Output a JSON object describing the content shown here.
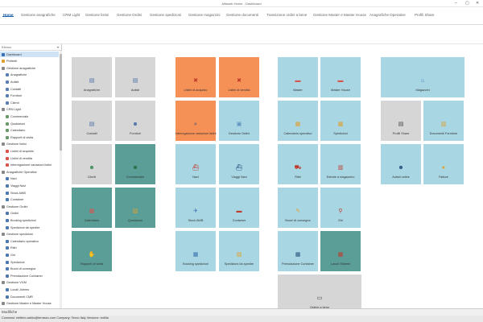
{
  "window": {
    "title": "Alfaweb Home - Dashboard"
  },
  "menu": {
    "tabs": [
      {
        "label": "Home",
        "active": true
      },
      {
        "label": "Gestione anagrafiche"
      },
      {
        "label": "CRM Light"
      },
      {
        "label": "Gestione listini"
      },
      {
        "label": "Gestione Ordini"
      },
      {
        "label": "Gestione spedizioni"
      },
      {
        "label": "Gestione magazzini"
      },
      {
        "label": "Gestione documenti"
      },
      {
        "label": "Transizione ordini a bene"
      },
      {
        "label": "Gestione Master e Master House"
      },
      {
        "label": "Anagrafiche Operative"
      },
      {
        "label": "Profili Share"
      }
    ]
  },
  "sidebar": {
    "header": "Elenco",
    "items": [
      {
        "label": "Dashboard",
        "level": 0,
        "color": "#3a6fb0",
        "selected": true
      },
      {
        "label": "Preferiti",
        "level": 0,
        "color": "#e0a030"
      },
      {
        "label": "Gestione anagrafiche",
        "level": 0,
        "color": "#888888"
      },
      {
        "label": "Anagrafiche",
        "level": 1,
        "color": "#5a7fb5"
      },
      {
        "label": "Autisti",
        "level": 1,
        "color": "#5a7fb5"
      },
      {
        "label": "Contatti",
        "level": 1,
        "color": "#5a7fb5"
      },
      {
        "label": "Fornitori",
        "level": 1,
        "color": "#5a7fb5"
      },
      {
        "label": "Clienti",
        "level": 1,
        "color": "#5a7fb5"
      },
      {
        "label": "CRM Light",
        "level": 0,
        "color": "#888888"
      },
      {
        "label": "Commerciale",
        "level": 1,
        "color": "#6a9a6a"
      },
      {
        "label": "Quotazioni",
        "level": 1,
        "color": "#6a9a6a"
      },
      {
        "label": "Calendario",
        "level": 1,
        "color": "#6a9a6a"
      },
      {
        "label": "Rapporti di visita",
        "level": 1,
        "color": "#6a9a6a"
      },
      {
        "label": "Gestione listini",
        "level": 0,
        "color": "#888888"
      },
      {
        "label": "Listini di acquisto",
        "level": 1,
        "color": "#d9534f"
      },
      {
        "label": "Listini di vendita",
        "level": 1,
        "color": "#d9534f"
      },
      {
        "label": "Interrogazione variazioni listini",
        "level": 1,
        "color": "#d9534f"
      },
      {
        "label": "Anagrafiche Operative",
        "level": 0,
        "color": "#888888"
      },
      {
        "label": "Navi",
        "level": 1,
        "color": "#4a7ab0"
      },
      {
        "label": "Viaggi Navi",
        "level": 1,
        "color": "#4a7ab0"
      },
      {
        "label": "Stock AWB",
        "level": 1,
        "color": "#4a7ab0"
      },
      {
        "label": "Container",
        "level": 1,
        "color": "#4a7ab0"
      },
      {
        "label": "Gestione Ordini",
        "level": 0,
        "color": "#888888"
      },
      {
        "label": "Ordini",
        "level": 1,
        "color": "#4a7ab0"
      },
      {
        "label": "Booking spedizioni",
        "level": 1,
        "color": "#4a7ab0"
      },
      {
        "label": "Spedizioni da spedire",
        "level": 1,
        "color": "#4a7ab0"
      },
      {
        "label": "Gestione spedizioni",
        "level": 0,
        "color": "#888888"
      },
      {
        "label": "Calendario operativo",
        "level": 1,
        "color": "#4a7ab0"
      },
      {
        "label": "Ritiri",
        "level": 1,
        "color": "#4a7ab0"
      },
      {
        "label": "Giri",
        "level": 1,
        "color": "#4a7ab0"
      },
      {
        "label": "Spedizioni",
        "level": 1,
        "color": "#4a7ab0"
      },
      {
        "label": "Buoni di consegna",
        "level": 1,
        "color": "#4a7ab0"
      },
      {
        "label": "Prenotazione Container",
        "level": 1,
        "color": "#4a7ab0"
      },
      {
        "label": "Gestione VGM",
        "level": 0,
        "color": "#888888"
      },
      {
        "label": "Locali Jolemo",
        "level": 1,
        "color": "#4a7ab0"
      },
      {
        "label": "Documenti CMR",
        "level": 1,
        "color": "#4a7ab0"
      },
      {
        "label": "Gestione Master e Master House",
        "level": 0,
        "color": "#888888"
      }
    ]
  },
  "tiles": [
    {
      "label": "Anagrafiche",
      "color": "gray",
      "icon": "id-card-icon",
      "glyph": "▤",
      "iconColor": "#4a6fa5",
      "col": 0,
      "row": 0
    },
    {
      "label": "Autisti",
      "color": "gray",
      "icon": "driver-card-icon",
      "glyph": "▤",
      "iconColor": "#4a6fa5",
      "col": 1,
      "row": 0
    },
    {
      "label": "Contatti",
      "color": "gray",
      "icon": "contact-card-icon",
      "glyph": "▤",
      "iconColor": "#4a6fa5",
      "col": 0,
      "row": 1
    },
    {
      "label": "Fornitori",
      "color": "gray",
      "icon": "suppliers-icon",
      "glyph": "☻",
      "iconColor": "#4a6fa5",
      "col": 1,
      "row": 1
    },
    {
      "label": "Clienti",
      "color": "gray",
      "icon": "clients-icon",
      "glyph": "☻",
      "iconColor": "#3c8c5a",
      "col": 0,
      "row": 2
    },
    {
      "label": "Commerciale",
      "color": "teal",
      "icon": "sales-people-icon",
      "glyph": "☻",
      "iconColor": "#2f6b4a",
      "col": 1,
      "row": 2
    },
    {
      "label": "Calendario",
      "color": "teal",
      "icon": "calendar-icon",
      "glyph": "▦",
      "iconColor": "#d9534f",
      "col": 0,
      "row": 3
    },
    {
      "label": "Quotazioni",
      "color": "teal",
      "icon": "quotes-icon",
      "glyph": "▧",
      "iconColor": "#e0a030",
      "col": 1,
      "row": 3
    },
    {
      "label": "Rapporti di visita",
      "color": "teal",
      "icon": "handshake-icon",
      "glyph": "✋",
      "iconColor": "#e0a030",
      "col": 0,
      "row": 4
    },
    {
      "label": "Listini di acquisto",
      "color": "orange",
      "icon": "purchase-price-list-icon",
      "glyph": "✖",
      "iconColor": "#c0392b",
      "col": 2,
      "row": 0
    },
    {
      "label": "Listini di vendita",
      "color": "orange",
      "icon": "sales-price-list-icon",
      "glyph": "✖",
      "iconColor": "#c0392b",
      "col": 3,
      "row": 0
    },
    {
      "label": "Interrogazione variazioni listini",
      "color": "orange",
      "icon": "magnifier-icon",
      "glyph": "⌕",
      "iconColor": "#2c4f7c",
      "col": 2,
      "row": 1
    },
    {
      "label": "Gestione Ordini",
      "color": "lblue",
      "icon": "orders-icon",
      "glyph": "▣",
      "iconColor": "#5a8fbf",
      "col": 3,
      "row": 1
    },
    {
      "label": "Navi",
      "color": "lblue",
      "icon": "ship-icon",
      "glyph": "⛴",
      "iconColor": "#c0392b",
      "col": 2,
      "row": 2
    },
    {
      "label": "Viaggi Navi",
      "color": "lblue",
      "icon": "ship-voyage-icon",
      "glyph": "⛴",
      "iconColor": "#2c4f7c",
      "col": 3,
      "row": 2
    },
    {
      "label": "Stock AWB",
      "color": "lblue",
      "icon": "airplane-icon",
      "glyph": "✈",
      "iconColor": "#3a6fb0",
      "col": 2,
      "row": 3
    },
    {
      "label": "Container",
      "color": "lblue",
      "icon": "container-icon",
      "glyph": "▬",
      "iconColor": "#c0392b",
      "col": 3,
      "row": 3
    },
    {
      "label": "Booking spedizioni",
      "color": "lblue",
      "icon": "booking-calendar-icon",
      "glyph": "▦",
      "iconColor": "#3a6fb0",
      "col": 2,
      "row": 4
    },
    {
      "label": "Spedizioni da spedire",
      "color": "lblue",
      "icon": "shipments-to-send-icon",
      "glyph": "▧",
      "iconColor": "#e0a030",
      "col": 3,
      "row": 4
    },
    {
      "label": "Master",
      "color": "lblue",
      "icon": "master-folder-icon",
      "glyph": "▬",
      "iconColor": "#d9534f",
      "col": 4,
      "row": 0
    },
    {
      "label": "Master House",
      "color": "lblue",
      "icon": "master-house-folder-icon",
      "glyph": "▬",
      "iconColor": "#d9534f",
      "col": 5,
      "row": 0
    },
    {
      "label": "Calendario operativo",
      "color": "lblue",
      "icon": "operational-calendar-icon",
      "glyph": "▦",
      "iconColor": "#e0a030",
      "col": 4,
      "row": 1
    },
    {
      "label": "Spedizioni",
      "color": "lblue",
      "icon": "shipments-icon",
      "glyph": "▩",
      "iconColor": "#e0a030",
      "col": 5,
      "row": 1
    },
    {
      "label": "Ritiri",
      "color": "lblue",
      "icon": "truck-icon",
      "glyph": "⛟",
      "iconColor": "#c0392b",
      "col": 4,
      "row": 2
    },
    {
      "label": "Entrate a magazzino",
      "color": "lblue",
      "icon": "warehouse-entry-icon",
      "glyph": "▥",
      "iconColor": "#c0392b",
      "col": 5,
      "row": 2
    },
    {
      "label": "Buoni di consegna",
      "color": "lblue",
      "icon": "delivery-notes-icon",
      "glyph": "✎",
      "iconColor": "#e0a030",
      "col": 4,
      "row": 3
    },
    {
      "label": "Giri",
      "color": "lblue",
      "icon": "map-pin-icon",
      "glyph": "⚲",
      "iconColor": "#c0392b",
      "col": 5,
      "row": 3
    },
    {
      "label": "Prenotazione Container",
      "color": "lblue",
      "icon": "container-booking-icon",
      "glyph": "▦",
      "iconColor": "#2c4f7c",
      "col": 4,
      "row": 4
    },
    {
      "label": "Lavori Sistemi",
      "color": "teal",
      "icon": "system-jobs-icon",
      "glyph": "▦",
      "iconColor": "#c0392b",
      "col": 5,
      "row": 4
    },
    {
      "label": "Ordine a bene",
      "color": "gray",
      "icon": "order-to-asset-icon",
      "glyph": "▭",
      "iconColor": "#333333",
      "col": 4,
      "row": 5,
      "wide": true
    },
    {
      "label": "Magazzini",
      "color": "lblue",
      "icon": "warehouse-icon",
      "glyph": "⌂",
      "iconColor": "#3a6fb0",
      "col": 6,
      "row": 0,
      "wide": true
    },
    {
      "label": "Profili Share",
      "color": "gray",
      "icon": "profile-share-icon",
      "glyph": "▤",
      "iconColor": "#444444",
      "col": 6,
      "row": 1
    },
    {
      "label": "Documenti Fornitore",
      "color": "lblue",
      "icon": "supplier-documents-icon",
      "glyph": "▧",
      "iconColor": "#e0a030",
      "col": 7,
      "row": 1
    },
    {
      "label": "Autisti online",
      "color": "lblue",
      "icon": "online-drivers-icon",
      "glyph": "☻",
      "iconColor": "#2c4f7c",
      "col": 6,
      "row": 2
    },
    {
      "label": "Fatture",
      "color": "lblue",
      "icon": "invoices-icon",
      "glyph": "●",
      "iconColor": "#e0a030",
      "col": 7,
      "row": 2
    }
  ],
  "statusbar": {
    "panel": "Modifiche",
    "info": "Connessi: elettrici.carbio@terrasec.com   Company: Teexo   Italy   Versione: trofilia"
  }
}
